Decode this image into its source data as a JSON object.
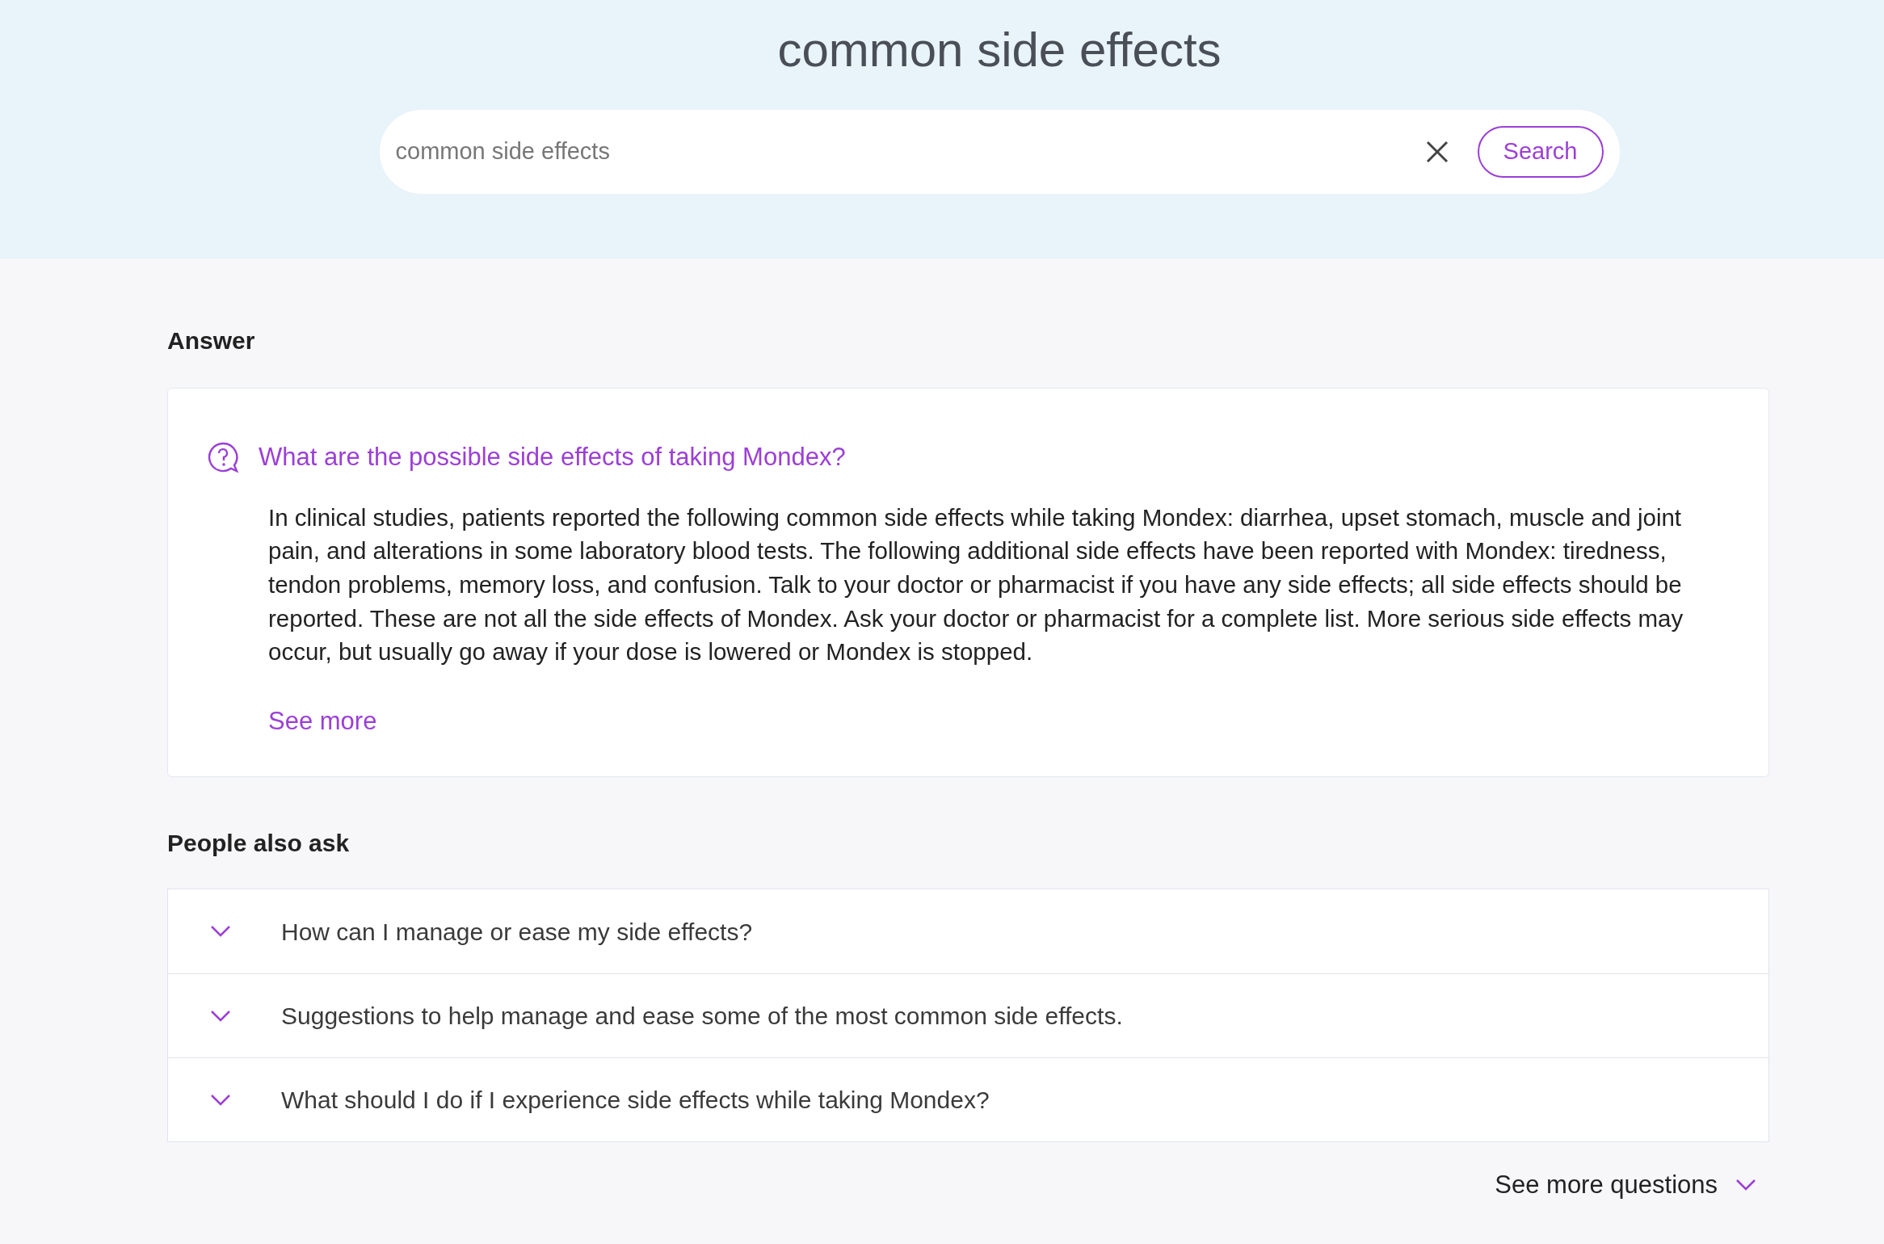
{
  "header": {
    "title": "common side effects",
    "search": {
      "value": "common side effects",
      "button": "Search"
    }
  },
  "answer": {
    "heading": "Answer",
    "question": "What are the possible side effects of taking Mondex?",
    "text": "In clinical studies, patients reported the following common side effects while taking Mondex: diarrhea, upset stomach, muscle and joint pain, and alterations in some laboratory blood tests. The following additional side effects have been reported with Mondex: tiredness, tendon problems, memory loss, and confusion. Talk to your doctor or pharmacist if you have any side effects; all side effects should be reported. These are not all the side effects of Mondex. Ask your doctor or pharmacist for a complete list. More serious side effects may occur, but usually go away if your dose is lowered or Mondex is stopped.",
    "link": "See more"
  },
  "people_also_ask": {
    "heading": "People also ask",
    "questions": [
      {
        "text": "How can I manage or ease my side effects?",
        "expanded": false
      },
      {
        "text": "Suggestions to help manage and ease some of the most common side effects.",
        "expanded": false
      },
      {
        "text": "What should I do if I experience side effects while taking Mondex?",
        "expanded": false
      }
    ],
    "more": "See more questions"
  }
}
